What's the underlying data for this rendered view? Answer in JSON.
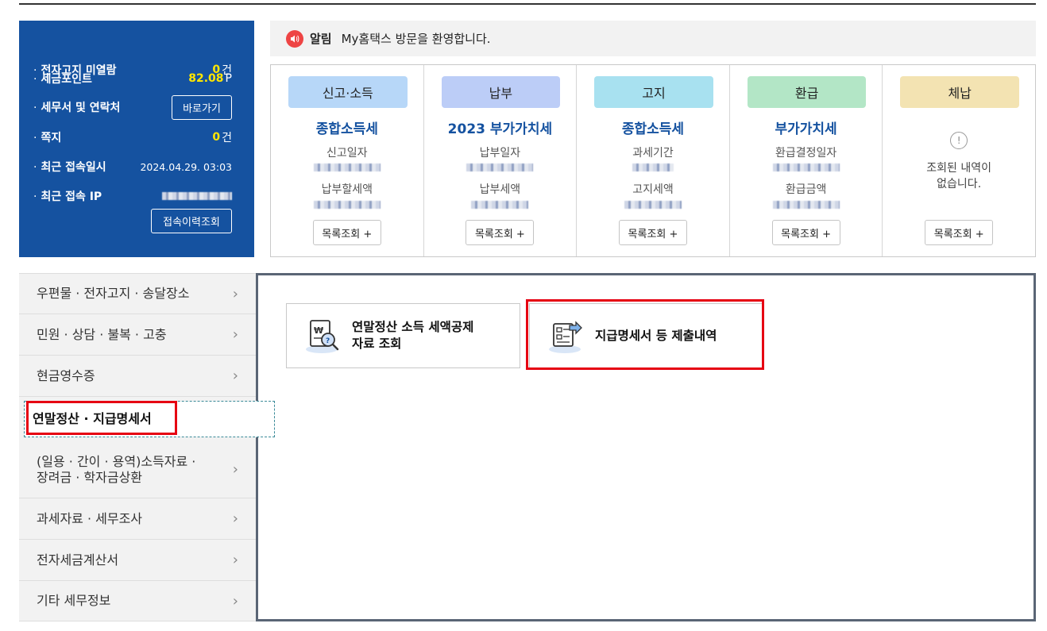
{
  "summary": {
    "rows": [
      {
        "label": "전자고지 미열람",
        "value": "0",
        "unit": "건"
      },
      {
        "label": "세금포인트",
        "value": "82.08",
        "unit": "P"
      },
      {
        "label": "세무서 및 연락처",
        "button": "바로가기"
      },
      {
        "label": "쪽지",
        "value": "0",
        "unit": "건"
      },
      {
        "label": "최근 접속일시",
        "datetime": "2024.04.29.  03:03"
      },
      {
        "label": "최근 접속 IP"
      }
    ],
    "history_button": "접속이력조회"
  },
  "notice": {
    "label": "알림",
    "message": "My홈택스 방문을 환영합니다."
  },
  "cards": [
    {
      "header": "신고·소득",
      "color": "#b7d7f8",
      "title": "종합소득세",
      "label1": "신고일자",
      "label2": "납부할세액",
      "button": "목록조회 +"
    },
    {
      "header": "납부",
      "color": "#bccdf7",
      "title": "2023 부가가치세",
      "label1": "납부일자",
      "label2": "납부세액",
      "button": "목록조회 +"
    },
    {
      "header": "고지",
      "color": "#a8e1f0",
      "title": "종합소득세",
      "label1": "과세기간",
      "label2": "고지세액",
      "button": "목록조회 +"
    },
    {
      "header": "환급",
      "color": "#b3e6c6",
      "title": "부가가치세",
      "label1": "환급결정일자",
      "label2": "환급금액",
      "button": "목록조회 +"
    },
    {
      "header": "체납",
      "color": "#f3e3b2",
      "empty_text_1": "조회된 내역이",
      "empty_text_2": "없습니다.",
      "button": "목록조회 +"
    }
  ],
  "menu": [
    {
      "label": "우편물 · 전자고지 · 송달장소"
    },
    {
      "label": "민원 · 상담 · 불복 · 고충"
    },
    {
      "label": "현금영수증"
    },
    {
      "label": "연말정산 · 지급명세서"
    },
    {
      "label1": "(일용 · 간이 · 용역)소득자료 ·",
      "label2": "장려금 · 학자금상환"
    },
    {
      "label": "과세자료 · 세무조사"
    },
    {
      "label": "전자세금계산서"
    },
    {
      "label": "기타 세무정보"
    }
  ],
  "services": [
    {
      "line1": "연말정산 소득 세액공제",
      "line2": "자료 조회"
    },
    {
      "line1": "지급명세서 등 제출내역"
    }
  ],
  "colors": {
    "brand_blue": "#1552a0",
    "highlight_red": "#e60012",
    "point_yellow": "#ffe600"
  }
}
